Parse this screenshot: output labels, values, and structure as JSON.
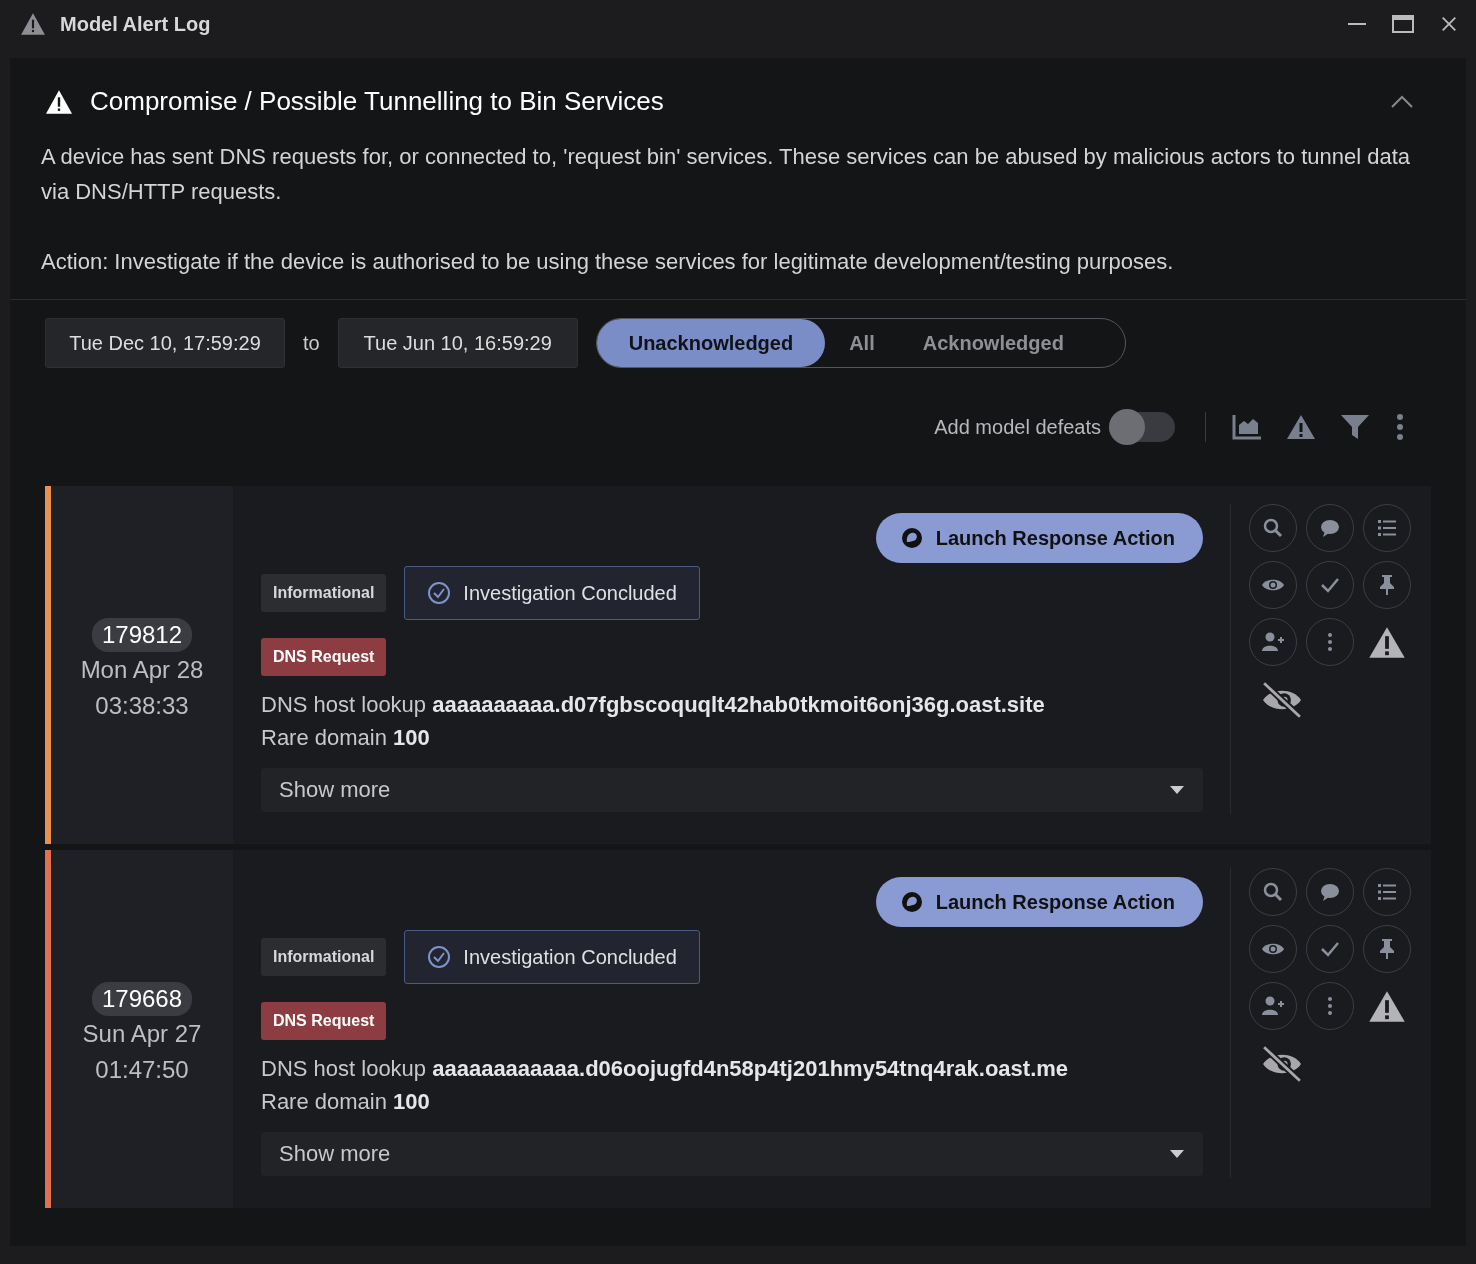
{
  "window": {
    "title": "Model Alert Log"
  },
  "model": {
    "title": "Compromise / Possible Tunnelling to Bin Services",
    "expanded": true,
    "description": [
      "A device has sent DNS requests for, or connected to, 'request bin' services. These services can be abused by malicious actors to tunnel data via DNS/HTTP requests.",
      "Action: Investigate if the device is authorised to be using these services for legitimate development/testing purposes."
    ]
  },
  "date_range": {
    "from": "Tue Dec 10, 17:59:29",
    "separator": "to",
    "to": "Tue Jun 10, 16:59:29"
  },
  "filters": [
    {
      "label": "Unacknowledged",
      "selected": true
    },
    {
      "label": "All",
      "selected": false
    },
    {
      "label": "Acknowledged",
      "selected": false
    }
  ],
  "toolbar": {
    "toggle_label": "Add model defeats",
    "toggle_on": false
  },
  "alerts": [
    {
      "color": "#e8924f",
      "id": "179812",
      "date": "Mon Apr 28",
      "time": "03:38:33",
      "launch_label": "Launch Response Action",
      "severity": "Informational",
      "status": "Investigation Concluded",
      "category": "DNS Request",
      "detail_label": "DNS host lookup",
      "detail_value": "aaaaaaaaaa.d07fgbscoquqlt42hab0tkmoit6onj36g.oast.site",
      "score_label": "Rare domain",
      "score_value": "100",
      "show_more": "Show more"
    },
    {
      "color": "#e0714f",
      "id": "179668",
      "date": "Sun Apr 27",
      "time": "01:47:50",
      "launch_label": "Launch Response Action",
      "severity": "Informational",
      "status": "Investigation Concluded",
      "category": "DNS Request",
      "detail_label": "DNS host lookup",
      "detail_value": "aaaaaaaaaaaa.d06oojugfd4n58p4tj201hmy54tnq4rak.oast.me",
      "score_label": "Rare domain",
      "score_value": "100",
      "show_more": "Show more"
    }
  ]
}
